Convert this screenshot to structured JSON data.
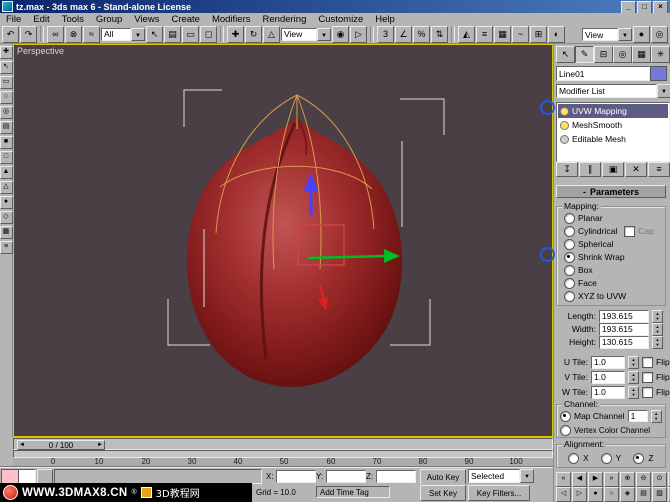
{
  "colors": {
    "annotation": "#2257e6",
    "object_swatch": "#7878d8",
    "viewport_bg": "#4a3f45",
    "peach_red": "#a12e2e",
    "active_viewport_border": "#d8c400",
    "stack_selection": "#5c5c84",
    "watermark_bg": "#000000"
  },
  "window": {
    "title": "tz.max - 3ds max 6 - Stand-alone License",
    "minimize": "_",
    "maximize": "□",
    "close": "×"
  },
  "menu": {
    "items": [
      "File",
      "Edit",
      "Tools",
      "Group",
      "Views",
      "Create",
      "Modifiers",
      "Rendering",
      "Customize",
      "Help"
    ]
  },
  "toolbar": {
    "icons": [
      "↶",
      "↷",
      "∞",
      "⊗",
      "≈",
      "↖",
      "▤",
      "▭",
      "◻",
      "✚",
      "↻",
      "△",
      "◉",
      "▷",
      "3",
      "∠",
      "%",
      "⇅",
      "◭",
      "≡",
      "▦",
      "~",
      "⊞",
      "◐"
    ],
    "filter_dropdown": "All",
    "coord_dropdown": "View",
    "right_dropdown": "View",
    "right_icons": [
      "●",
      "◎"
    ]
  },
  "left_toolbar": {
    "icons": [
      "✚",
      "↖",
      "▭",
      "○",
      "◎",
      "▤",
      "■",
      "□",
      "▲",
      "△",
      "●",
      "◇",
      "▦",
      "≡"
    ]
  },
  "viewport": {
    "label": "Perspective"
  },
  "command_panel": {
    "tabs": [
      "↖",
      "✎",
      "⊟",
      "◎",
      "▦",
      "✳"
    ],
    "object_name": "Line01",
    "modifier_list": "Modifier List",
    "stack": [
      "UVW Mapping",
      "MeshSmooth",
      "Editable Mesh"
    ],
    "stack_buttons": [
      "↧",
      "∥",
      "▣",
      "✕",
      "≡"
    ],
    "rollout_collapse": "-",
    "rollout_title": "Parameters",
    "mapping": {
      "title": "Mapping:",
      "options": [
        "Planar",
        "Cylindrical",
        "Spherical",
        "Shrink Wrap",
        "Box",
        "Face",
        "XYZ to UVW"
      ],
      "selected": "Shrink Wrap",
      "cap": "Cap"
    },
    "dims": [
      {
        "label": "Length:",
        "value": "193.615"
      },
      {
        "label": "Width:",
        "value": "193.615"
      },
      {
        "label": "Height:",
        "value": "130.615"
      }
    ],
    "tiles": [
      {
        "label": "U Tile:",
        "value": "1.0",
        "flip": "Flip"
      },
      {
        "label": "V Tile:",
        "value": "1.0",
        "flip": "Flip"
      },
      {
        "label": "W Tile:",
        "value": "1.0",
        "flip": "Flip"
      }
    ],
    "channel": {
      "title": "Channel:",
      "map_channel": "Map Channel",
      "map_value": "1",
      "vertex_color": "Vertex Color Channel"
    },
    "alignment": {
      "title": "Alignment:",
      "x": "X",
      "y": "Y",
      "z": "Z",
      "selected": "Z"
    }
  },
  "timeline": {
    "prev": "◄",
    "next": "►",
    "handle": "0 / 100",
    "ticks": [
      "0",
      "10",
      "20",
      "30",
      "40",
      "50",
      "60",
      "70",
      "80",
      "90",
      "100"
    ]
  },
  "status": {
    "x_label": "X:",
    "y_label": "Y:",
    "z_label": "Z:",
    "grid": "Grid = 10.0",
    "add_time_tag": "Add Time Tag",
    "auto_key": "Auto Key",
    "selected": "Selected",
    "set_key": "Set Key",
    "key_filters": "Key Filters..."
  },
  "playback": {
    "row1": [
      "«",
      "◀",
      "▶",
      "»",
      "⊕",
      "⊖",
      "⊙",
      "✚"
    ],
    "row2": [
      "◁",
      "▷",
      "●",
      "○",
      "◈",
      "▤",
      "▧",
      "▥"
    ]
  },
  "watermark": {
    "site": "WWW.3DMAX8.CN",
    "reg": "®",
    "cn": "3D教程网"
  }
}
